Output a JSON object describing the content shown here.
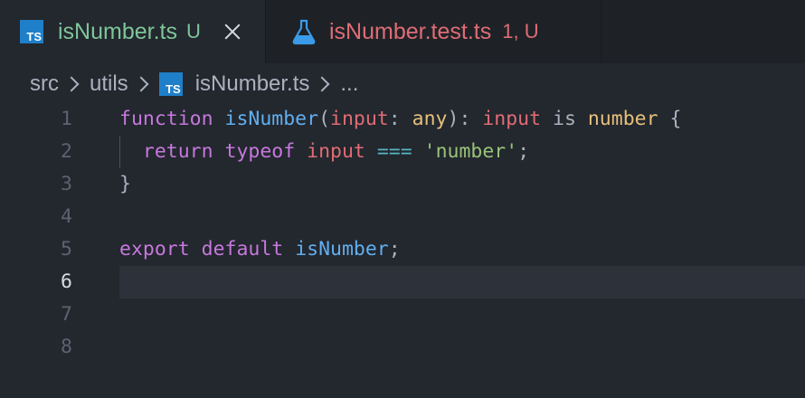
{
  "tabs": [
    {
      "label": "isNumber.ts",
      "status": "U",
      "icon": "typescript-file-icon"
    },
    {
      "label": "isNumber.test.ts",
      "status": "1, U",
      "icon": "flask-icon"
    }
  ],
  "breadcrumb": {
    "items": [
      "src",
      "utils",
      "isNumber.ts",
      "..."
    ],
    "file_icon_text": "TS"
  },
  "editor": {
    "line_numbers": [
      "1",
      "2",
      "3",
      "4",
      "5",
      "6",
      "7",
      "8"
    ],
    "current_line": "6",
    "lines": {
      "l1": [
        "function",
        " ",
        "isNumber",
        "(",
        "input",
        ": ",
        "any",
        "): ",
        "input",
        " is ",
        "number",
        " {"
      ],
      "l2": [
        "  ",
        "return",
        " ",
        "typeof",
        " ",
        "input",
        " ",
        "===",
        " ",
        "'number'",
        ";"
      ],
      "l3": [
        "}"
      ],
      "l5": [
        "export",
        " ",
        "default",
        " ",
        "isNumber",
        ";"
      ]
    }
  },
  "colors": {
    "keyword": "#c678dd",
    "function": "#61afef",
    "parameter": "#e06c75",
    "type": "#e5c07b",
    "string": "#98c379",
    "operator": "#56b6c2",
    "modified_green": "#7ec699",
    "error_red": "#e06c75"
  }
}
